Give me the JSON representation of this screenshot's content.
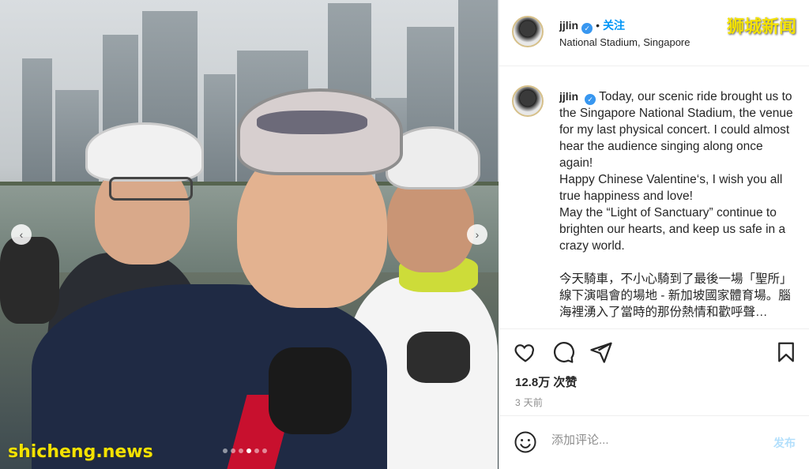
{
  "post": {
    "username": "jjlin",
    "follow_label": "关注",
    "separator": "•",
    "location": "National Stadium, Singapore",
    "caption_en": "Today, our scenic ride brought us to the Singapore National Stadium, the venue for my last physical concert. I could almost hear the audience singing along once again!\nHappy Chinese Valentine‘s, I wish you all true happiness and love!\nMay the “Light of Sanctuary” continue to brighten our hearts, and keep us safe in a crazy world.\n\n今天騎車，不小心騎到了最後一場「聖所」線下演唱會的場地 - 新加坡國家體育場。腦海裡湧入了當時的那份熱情和歡呼聲…",
    "likes": "12.8万 次赞",
    "time_ago": "3 天前"
  },
  "comment": {
    "placeholder": "添加评论...",
    "post_label": "发布"
  },
  "watermarks": {
    "cn": "狮城新闻",
    "en": "shicheng.news"
  },
  "icons": {
    "like": "heart-icon",
    "comment": "comment-icon",
    "share": "paper-plane-icon",
    "save": "bookmark-icon",
    "emoji": "smiley-icon",
    "verified": "verified-badge-icon",
    "prev": "chevron-left-icon",
    "next": "chevron-right-icon"
  },
  "carousel": {
    "slide_count": 6,
    "active_index": 3
  },
  "colors": {
    "link": "#0095f6",
    "verified": "#3897f0",
    "watermark": "#f4e200",
    "muted": "#8e8e8e"
  }
}
